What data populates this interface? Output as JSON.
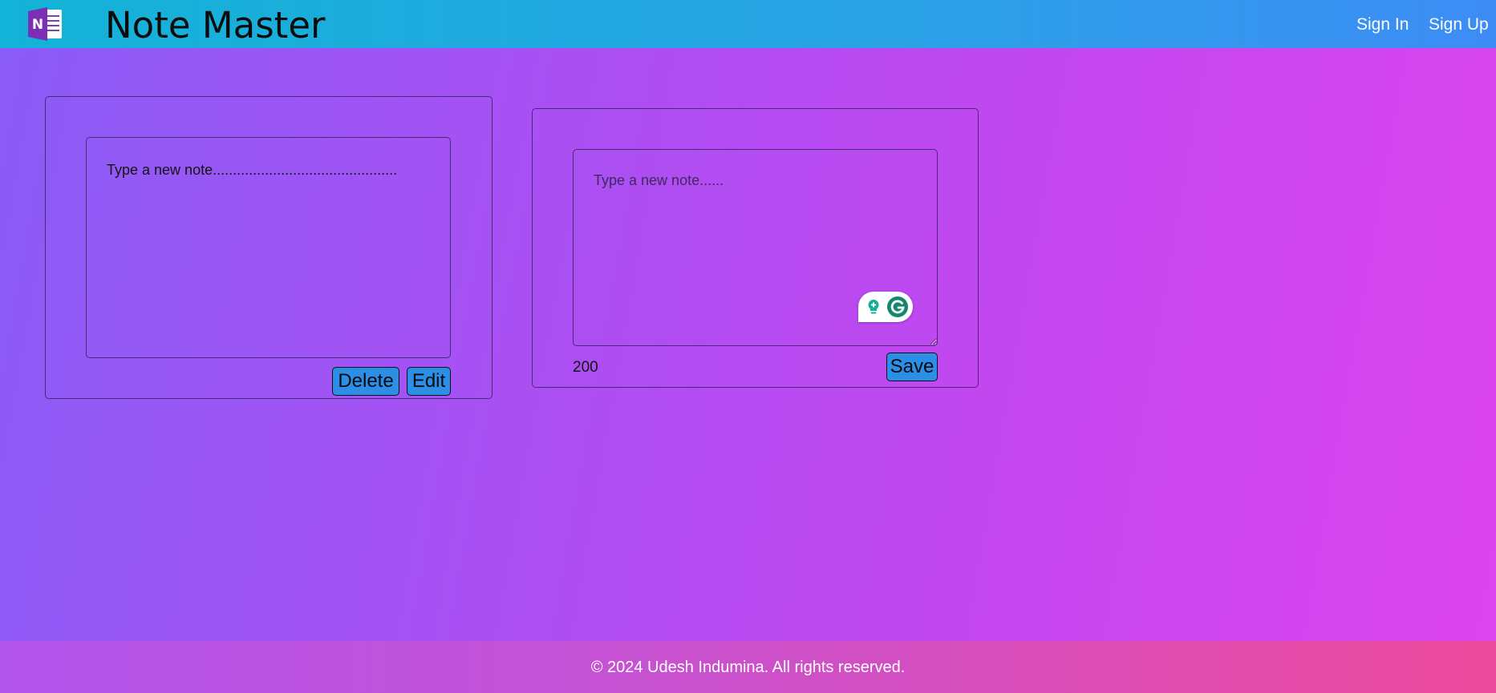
{
  "header": {
    "title": "Note Master",
    "nav": {
      "sign_in": "Sign In",
      "sign_up": "Sign Up"
    },
    "logo_icon": "onenote-logo-icon"
  },
  "notes": [
    {
      "text": "Type a new note..............................................",
      "delete_label": "Delete",
      "edit_label": "Edit"
    }
  ],
  "composer": {
    "placeholder": "Type a new note......",
    "value": "",
    "char_remaining": "200",
    "save_label": "Save",
    "extension_icon": "grammarly-icon"
  },
  "footer": {
    "copyright": "© 2024 Udesh Indumina. All rights reserved."
  },
  "colors": {
    "header_start": "#12b3d6",
    "header_end": "#3d8cf5",
    "button_bg": "#2b8fe8",
    "page_bg_start": "#8a5cf6",
    "page_bg_end": "#dc44ee",
    "footer_end": "#ec4a9c"
  }
}
